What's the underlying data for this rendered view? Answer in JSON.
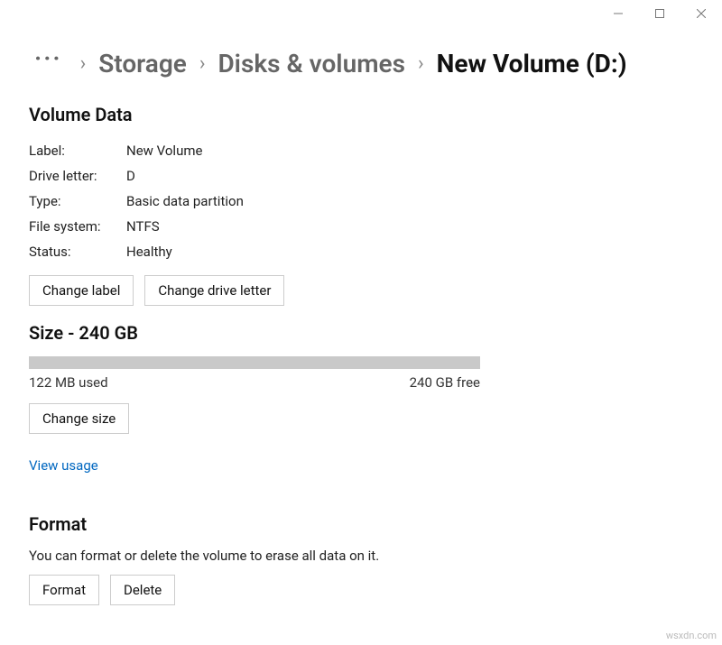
{
  "breadcrumb": {
    "items": [
      "Storage",
      "Disks & volumes",
      "New Volume (D:)"
    ]
  },
  "volume_data": {
    "heading": "Volume Data",
    "label_key": "Label:",
    "label_val": "New Volume",
    "drive_key": "Drive letter:",
    "drive_val": "D",
    "type_key": "Type:",
    "type_val": "Basic data partition",
    "fs_key": "File system:",
    "fs_val": "NTFS",
    "status_key": "Status:",
    "status_val": "Healthy",
    "change_label_btn": "Change label",
    "change_drive_btn": "Change drive letter"
  },
  "size": {
    "heading": "Size - 240 GB",
    "used": "122 MB used",
    "free": "240 GB free",
    "change_size_btn": "Change size",
    "view_usage": "View usage"
  },
  "format": {
    "heading": "Format",
    "desc": "You can format or delete the volume to erase all data on it.",
    "format_btn": "Format",
    "delete_btn": "Delete"
  },
  "watermark": "wsxdn.com"
}
